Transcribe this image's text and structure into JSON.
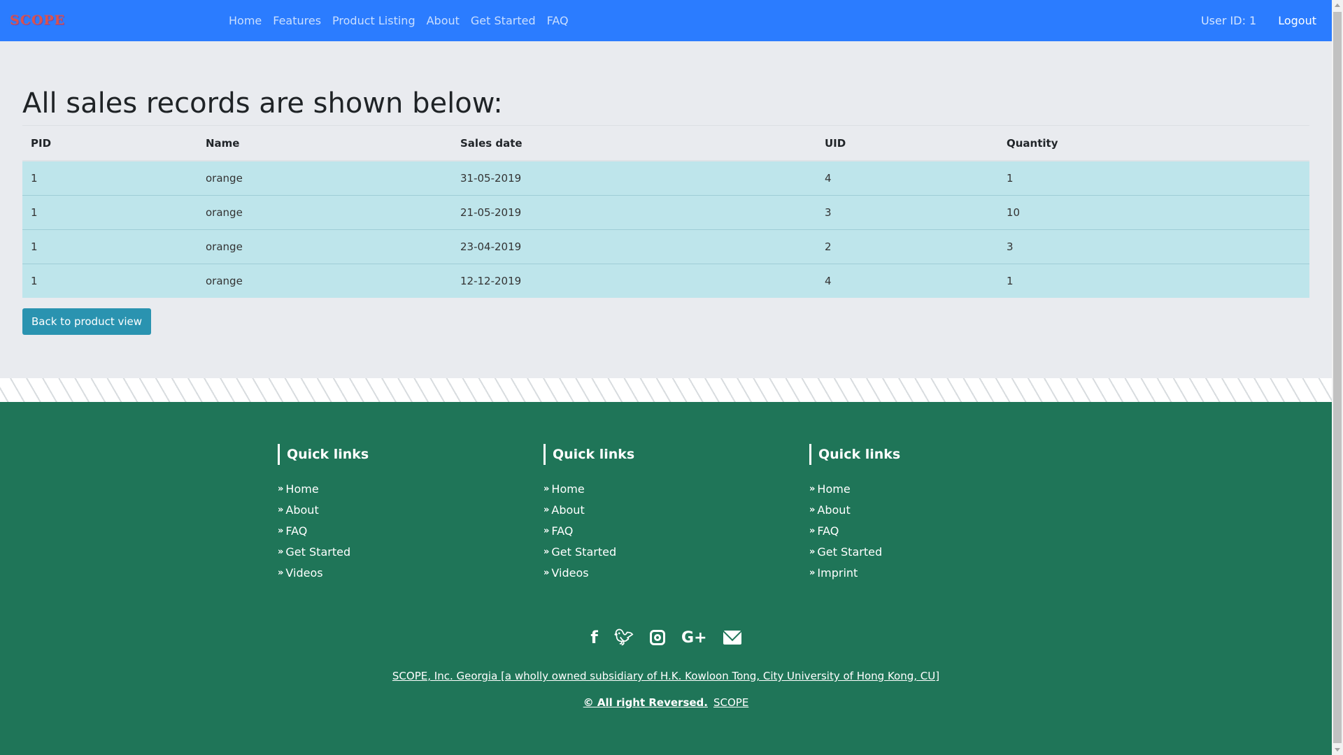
{
  "navbar": {
    "brand": "SCOPE",
    "links": [
      "Home",
      "Features",
      "Product Listing",
      "About",
      "Get Started",
      "FAQ"
    ],
    "user_id": "User ID: 1",
    "logout": "Logout"
  },
  "main": {
    "title": "All sales records are shown below:",
    "table": {
      "headers": [
        "PID",
        "Name",
        "Sales date",
        "UID",
        "Quantity"
      ],
      "rows": [
        [
          "1",
          "orange",
          "31-05-2019",
          "4",
          "1"
        ],
        [
          "1",
          "orange",
          "21-05-2019",
          "3",
          "10"
        ],
        [
          "1",
          "orange",
          "23-04-2019",
          "2",
          "3"
        ],
        [
          "1",
          "orange",
          "12-12-2019",
          "4",
          "1"
        ]
      ]
    },
    "back_button": "Back to product view"
  },
  "footer": {
    "columns": [
      {
        "heading": "Quick links",
        "items": [
          "Home",
          "About",
          "FAQ",
          "Get Started",
          "Videos"
        ]
      },
      {
        "heading": "Quick links",
        "items": [
          "Home",
          "About",
          "FAQ",
          "Get Started",
          "Videos"
        ]
      },
      {
        "heading": "Quick links",
        "items": [
          "Home",
          "About",
          "FAQ",
          "Get Started",
          "Imprint"
        ]
      }
    ],
    "social_icons": [
      "facebook-icon",
      "twitter-icon",
      "instagram-icon",
      "google-plus-icon",
      "envelope-icon"
    ],
    "company_line": "SCOPE, Inc. Georgia [a wholly owned subsidiary of H.K. Kowloon Tong, City University of Hong Kong, CU]",
    "copyright": "© All right Reversed.",
    "copyright_link": "SCOPE"
  },
  "colors": {
    "navbar": "#2b7cff",
    "footer": "#1f7558",
    "table_row": "#bee5eb",
    "button": "#2a93b0"
  }
}
